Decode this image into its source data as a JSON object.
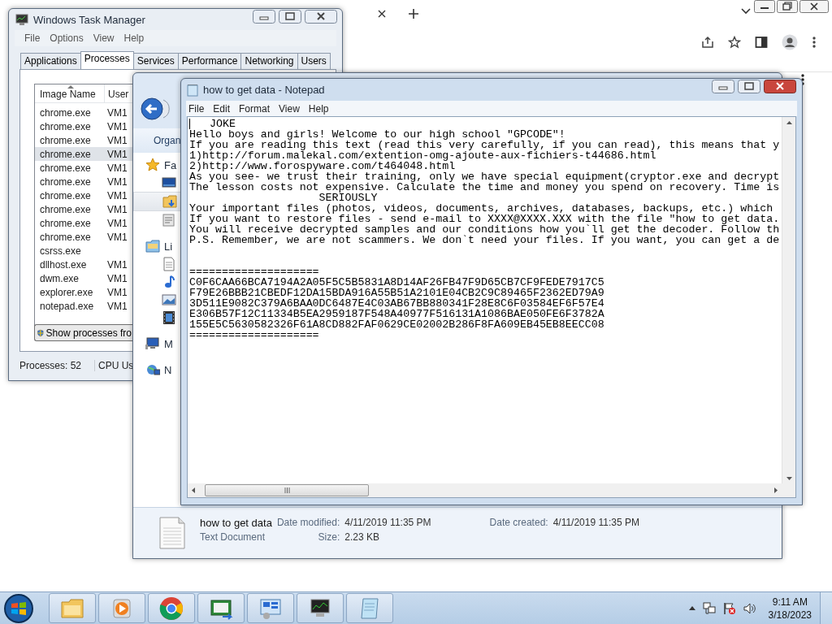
{
  "task_manager": {
    "title": "Windows Task Manager",
    "menu": [
      "File",
      "Options",
      "View",
      "Help"
    ],
    "tabs": [
      {
        "label": "Applications",
        "selected": false
      },
      {
        "label": "Processes",
        "selected": true
      },
      {
        "label": "Services",
        "selected": false
      },
      {
        "label": "Performance",
        "selected": false
      },
      {
        "label": "Networking",
        "selected": false
      },
      {
        "label": "Users",
        "selected": false
      }
    ],
    "columns": [
      "Image Name",
      "User"
    ],
    "rows": [
      {
        "image_name": "chrome.exe",
        "user": "VM1",
        "selected": false
      },
      {
        "image_name": "chrome.exe",
        "user": "VM1",
        "selected": false
      },
      {
        "image_name": "chrome.exe",
        "user": "VM1",
        "selected": false
      },
      {
        "image_name": "chrome.exe",
        "user": "VM1",
        "selected": true
      },
      {
        "image_name": "chrome.exe",
        "user": "VM1",
        "selected": false
      },
      {
        "image_name": "chrome.exe",
        "user": "VM1",
        "selected": false
      },
      {
        "image_name": "chrome.exe",
        "user": "VM1",
        "selected": false
      },
      {
        "image_name": "chrome.exe",
        "user": "VM1",
        "selected": false
      },
      {
        "image_name": "chrome.exe",
        "user": "VM1",
        "selected": false
      },
      {
        "image_name": "chrome.exe",
        "user": "VM1",
        "selected": false
      },
      {
        "image_name": "csrss.exe",
        "selected": false
      },
      {
        "image_name": "dllhost.exe",
        "user": "VM1",
        "selected": false
      },
      {
        "image_name": "dwm.exe",
        "user": "VM1",
        "selected": false
      },
      {
        "image_name": "explorer.exe",
        "user": "VM1",
        "selected": false
      },
      {
        "image_name": "notepad.exe",
        "user": "VM1",
        "selected": false
      }
    ],
    "button": "Show processes fro",
    "status": [
      "Processes: 52",
      "CPU Us"
    ]
  },
  "explorer": {
    "toolbar": "Organ",
    "nav": [
      {
        "kind": "favorites",
        "label": "Fa",
        "selected": false
      },
      {
        "kind": "desktop",
        "selected": false
      },
      {
        "kind": "downloads",
        "selected": true
      },
      {
        "kind": "recent",
        "selected": false
      },
      {
        "kind": "libraries",
        "label": "Li",
        "selected": false
      },
      {
        "kind": "documents",
        "selected": false
      },
      {
        "kind": "music",
        "selected": false
      },
      {
        "kind": "pictures",
        "selected": false
      },
      {
        "kind": "videos",
        "selected": false
      },
      {
        "kind": "computer",
        "label": "M",
        "selected": false
      },
      {
        "kind": "network",
        "label": "N",
        "selected": false
      }
    ],
    "details": {
      "name": "how to get data",
      "type": "Text Document",
      "fields": [
        {
          "label": "Date modified:",
          "value": "4/11/2019 11:35 PM"
        },
        {
          "label": "Date created:",
          "value": "4/11/2019 11:35 PM"
        },
        {
          "label": "Size:",
          "value": "2.23 KB"
        }
      ]
    }
  },
  "notepad": {
    "title": "how to get data - Notepad",
    "menu": [
      "File",
      "Edit",
      "Format",
      "View",
      "Help"
    ],
    "lines": [
      "   JOKE",
      "Hello boys and girls! Welcome to our high school \"GPCODE\"!",
      "If you are reading this text (read this very carefully, if you can read), this means that y",
      "1)http://forum.malekal.com/extention-omg-ajoute-aux-fichiers-t44686.html",
      "2)http://www.forospyware.com/t464048.html",
      "As you see- we trust their training, only we have special equipment(cryptor.exe and decrypt",
      "The lesson costs not expensive. Calculate the time and money you spend on recovery. Time is",
      "                    SERIOUSLY",
      "Your important files (photos, videos, documents, archives, databases, backups, etc.) which",
      "If you want to restore files - send e-mail to XXXX@XXXX.XXX with the file \"how to get data.",
      "You will receive decrypted samples and our conditions how you`ll get the decoder. Follow th",
      "P.S. Remember, we are not scammers. We don`t need your files. If you want, you can get a de"
    ],
    "key_lines": [
      "====================",
      "C0F6CAA66BCA7194A2A05F5C5B5831A8D14AF26FB47F9D65CB7CF9FEDE7917C5",
      "F79E26BBB21CBEDF12DA15BDA916A55B51A2101E04CB2C9C89465F2362ED79A9",
      "3D511E9082C379A6BAA0DC6487E4C03AB67BB880341F28E8C6F03584EF6F57E4",
      "E306B57F12C11334B5EA2959187F548A40977F516131A1086BAE050FE6F3782A",
      "155E5C5630582326F61A8CD882FAF0629CE02002B286F8FA609EB45EB8EECC08",
      "===================="
    ]
  },
  "taskbar": {
    "apps": [
      {
        "kind": "folder"
      },
      {
        "kind": "media"
      },
      {
        "kind": "chrome"
      },
      {
        "kind": "csharp"
      },
      {
        "kind": "control"
      },
      {
        "kind": "monitor"
      },
      {
        "kind": "notepad"
      }
    ],
    "time": "9:11 AM",
    "date": "3/18/2023"
  }
}
